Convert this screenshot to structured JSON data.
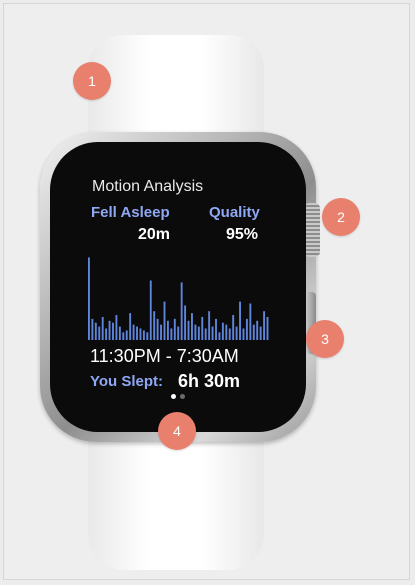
{
  "screen": {
    "title": "Motion Analysis",
    "fell_asleep_label": "Fell Asleep",
    "fell_asleep_value": "20m",
    "quality_label": "Quality",
    "quality_value": "95%",
    "time_range": "11:30PM - 7:30AM",
    "slept_label": "You Slept:",
    "slept_value": "6h 30m",
    "page_indicator": {
      "total": 2,
      "active": 1
    }
  },
  "motion_bars": [
    86,
    22,
    18,
    14,
    24,
    12,
    20,
    18,
    26,
    14,
    8,
    10,
    28,
    16,
    14,
    12,
    10,
    8,
    62,
    30,
    22,
    16,
    40,
    20,
    12,
    22,
    14,
    60,
    36,
    20,
    28,
    16,
    14,
    24,
    12,
    30,
    14,
    22,
    8,
    18,
    16,
    12,
    26,
    14,
    40,
    12,
    22,
    38,
    16,
    20,
    14,
    30,
    24
  ],
  "markers": [
    {
      "label": "1"
    },
    {
      "label": "2"
    },
    {
      "label": "3"
    },
    {
      "label": "4"
    }
  ],
  "colors": {
    "accent_label": "#8fa8f5",
    "bar": "#5f86dc",
    "marker": "#e8806d",
    "screen_bg": "#0b0b0b"
  }
}
